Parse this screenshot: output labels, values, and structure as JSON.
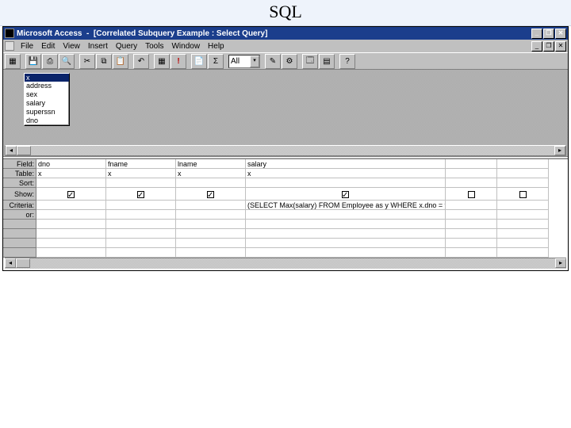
{
  "page_heading": "SQL",
  "titlebar": {
    "app": "Microsoft Access",
    "doc": "[Correlated Subquery Example : Select Query]"
  },
  "window_controls": {
    "min": "_",
    "max": "❐",
    "close": "✕"
  },
  "menu": [
    "File",
    "Edit",
    "View",
    "Insert",
    "Query",
    "Tools",
    "Window",
    "Help"
  ],
  "toolbar": {
    "sigma": "Σ",
    "bang": "!",
    "all_combo": "All",
    "icons": {
      "view": "▦",
      "save": "💾",
      "print": "⎙",
      "preview": "🔍",
      "cut": "✂",
      "copy": "⧉",
      "paste": "📋",
      "undo": "↶",
      "qtype": "▦",
      "props": "📄",
      "build": "⚙",
      "db": "🗔",
      "newobj": "▤",
      "help": "?"
    }
  },
  "fieldlist": {
    "title": "x",
    "items": [
      "address",
      "sex",
      "salary",
      "superssn",
      "dno"
    ]
  },
  "grid": {
    "row_labels": [
      "Field:",
      "Table:",
      "Sort:",
      "Show:",
      "Criteria:",
      "or:"
    ],
    "columns": [
      {
        "field": "dno",
        "table": "x",
        "show": true,
        "criteria": ""
      },
      {
        "field": "fname",
        "table": "x",
        "show": true,
        "criteria": ""
      },
      {
        "field": "lname",
        "table": "x",
        "show": true,
        "criteria": ""
      },
      {
        "field": "salary",
        "table": "x",
        "show": true,
        "criteria": "(SELECT Max(salary) FROM Employee as y WHERE x.dno = y.dno)"
      },
      {
        "field": "",
        "table": "",
        "show": false,
        "criteria": ""
      },
      {
        "field": "",
        "table": "",
        "show": false,
        "criteria": ""
      }
    ]
  }
}
